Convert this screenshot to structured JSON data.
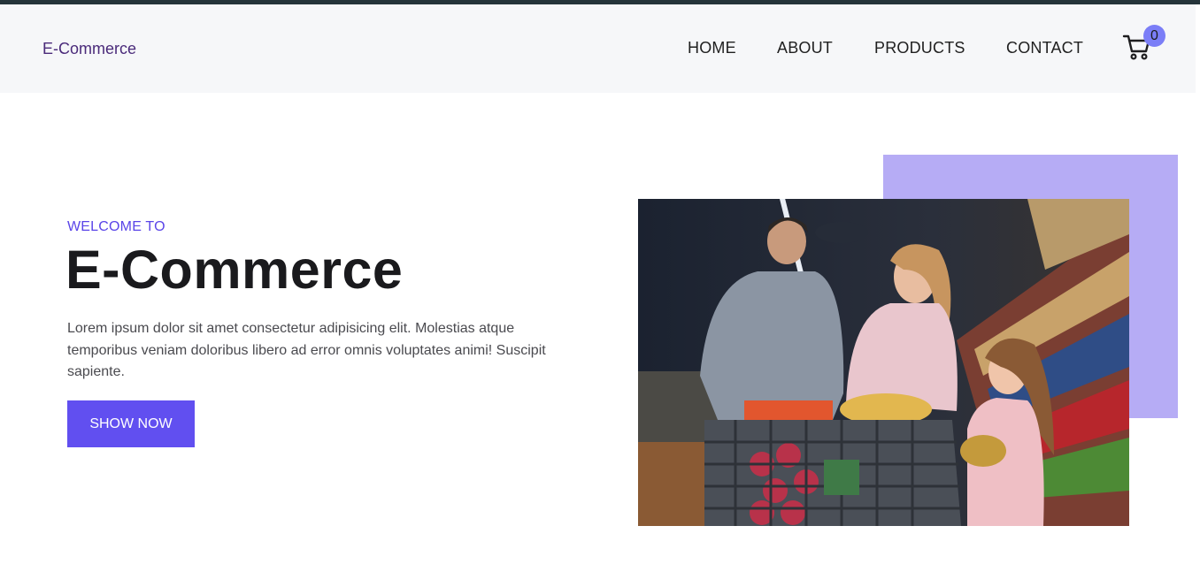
{
  "navbar": {
    "brand": "E-Commerce",
    "links": [
      "HOME",
      "ABOUT",
      "PRODUCTS",
      "CONTACT"
    ],
    "cart_count": "0",
    "cart_icon": "cart-icon"
  },
  "hero": {
    "eyebrow": "WELCOME TO",
    "title": "E-Commerce",
    "text": "Lorem ipsum dolor sit amet consectetur adipisicing elit. Molestias atque temporibus veniam doloribus libero ad error omnis voluptates animi! Suscipit sapiente.",
    "button_label": "SHOW NOW"
  },
  "colors": {
    "accent": "#614ff0",
    "accent_light": "#b6acf5",
    "badge": "#7b7ef7",
    "navbar_bg": "#f6f7f9"
  }
}
